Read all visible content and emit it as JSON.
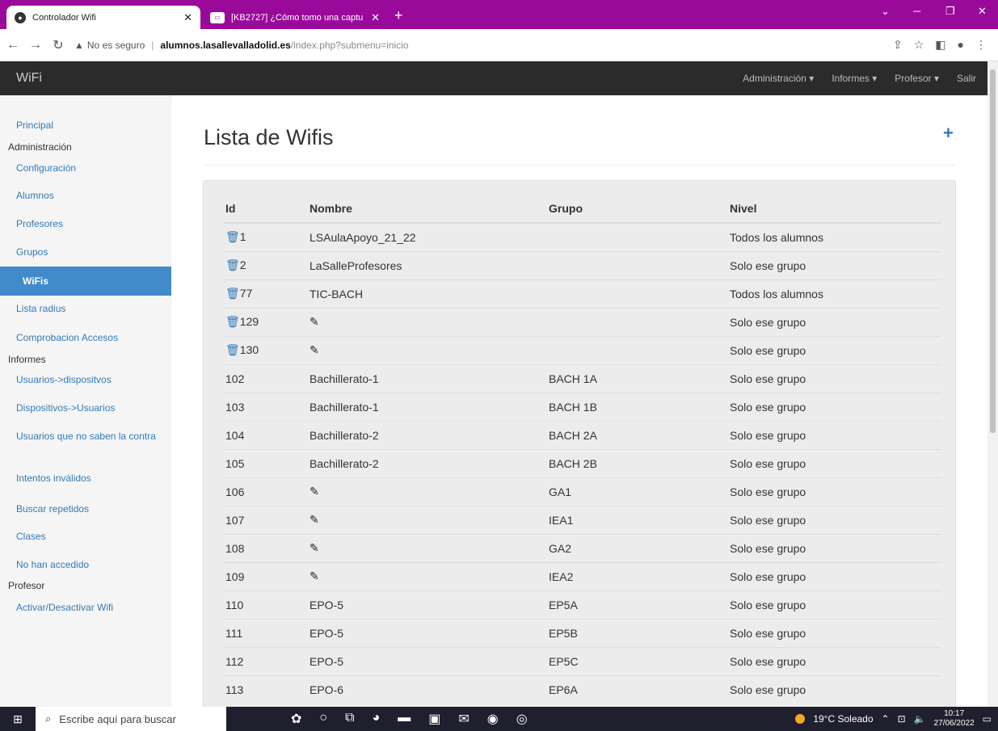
{
  "browser": {
    "tabs": [
      {
        "title": "Controlador Wifi",
        "favicon": "globe-icon",
        "active": true
      },
      {
        "title": "[KB2727] ¿Cómo tomo una captu",
        "favicon": "kb-icon",
        "active": false
      }
    ],
    "new_tab": "+",
    "security_label": "No es seguro",
    "url_host": "alumnos.lasallevalladolid.es",
    "url_path": "/index.php?submenu=inicio"
  },
  "navbar": {
    "brand": "WiFi",
    "menus": [
      "Administración ▾",
      "Informes ▾",
      "Profesor ▾",
      "Salir"
    ]
  },
  "sidebar": {
    "principal": "Principal",
    "admin_header": "Administración",
    "admin_items": [
      "Configuración",
      "Alumnos",
      "Profesores",
      "Grupos",
      "WiFis",
      "Lista radius",
      "Comprobacion Accesos"
    ],
    "informes_header": "Informes",
    "informes_items": [
      "Usuarios->dispositvos",
      "Dispositivos->Usuarios",
      "Usuarios que no saben la contra",
      "Intentos inválidos",
      "Buscar repetidos",
      "Clases",
      "No han accedido"
    ],
    "profesor_header": "Profesor",
    "profesor_items": [
      "Activar/Desactivar Wifi"
    ]
  },
  "main": {
    "title": "Lista de Wifis",
    "add_icon": "+",
    "columns": [
      "Id",
      "Nombre",
      "Grupo",
      "Nivel"
    ],
    "rows": [
      {
        "id": "1",
        "deletable": true,
        "name": "LSAulaApoyo_21_22",
        "group": "",
        "level": "Todos los alumnos"
      },
      {
        "id": "2",
        "deletable": true,
        "name": "LaSalleProfesores",
        "group": "",
        "level": "Solo ese grupo"
      },
      {
        "id": "77",
        "deletable": true,
        "name": "TIC-BACH",
        "group": "",
        "level": "Todos los alumnos"
      },
      {
        "id": "129",
        "deletable": true,
        "name": "",
        "group": "",
        "level": "Solo ese grupo"
      },
      {
        "id": "130",
        "deletable": true,
        "name": "",
        "group": "",
        "level": "Solo ese grupo"
      },
      {
        "id": "102",
        "deletable": false,
        "name": "Bachillerato-1",
        "group": "BACH 1A",
        "level": "Solo ese grupo"
      },
      {
        "id": "103",
        "deletable": false,
        "name": "Bachillerato-1",
        "group": "BACH 1B",
        "level": "Solo ese grupo"
      },
      {
        "id": "104",
        "deletable": false,
        "name": "Bachillerato-2",
        "group": "BACH 2A",
        "level": "Solo ese grupo"
      },
      {
        "id": "105",
        "deletable": false,
        "name": "Bachillerato-2",
        "group": "BACH 2B",
        "level": "Solo ese grupo"
      },
      {
        "id": "106",
        "deletable": false,
        "name": "",
        "group": "GA1",
        "level": "Solo ese grupo"
      },
      {
        "id": "107",
        "deletable": false,
        "name": "",
        "group": "IEA1",
        "level": "Solo ese grupo"
      },
      {
        "id": "108",
        "deletable": false,
        "name": "",
        "group": "GA2",
        "level": "Solo ese grupo"
      },
      {
        "id": "109",
        "deletable": false,
        "name": "",
        "group": "IEA2",
        "level": "Solo ese grupo"
      },
      {
        "id": "110",
        "deletable": false,
        "name": "EPO-5",
        "group": "EP5A",
        "level": "Solo ese grupo"
      },
      {
        "id": "111",
        "deletable": false,
        "name": "EPO-5",
        "group": "EP5B",
        "level": "Solo ese grupo"
      },
      {
        "id": "112",
        "deletable": false,
        "name": "EPO-5",
        "group": "EP5C",
        "level": "Solo ese grupo"
      },
      {
        "id": "113",
        "deletable": false,
        "name": "EPO-6",
        "group": "EP6A",
        "level": "Solo ese grupo"
      }
    ]
  },
  "taskbar": {
    "search_placeholder": "Escribe aquí para buscar",
    "weather": "19°C Soleado",
    "time": "10:17",
    "date": "27/06/2022"
  },
  "colors": {
    "tabbar": "#9a0a9a",
    "navbar": "#2b2b2b",
    "link": "#337ab7",
    "active_item": "#428bca"
  }
}
